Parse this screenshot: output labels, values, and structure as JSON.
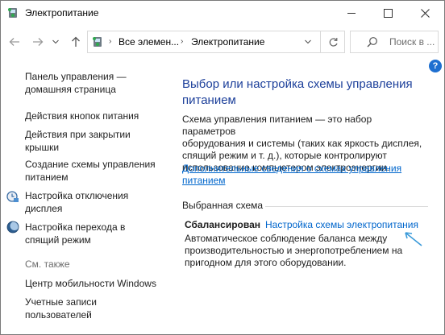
{
  "window": {
    "title": "Электропитание",
    "app_icon": "power-options-icon",
    "controls": [
      "minimize-icon",
      "maximize-icon",
      "close-icon"
    ]
  },
  "address_bar": {
    "breadcrumbs": [
      "Все элемен...",
      "Электропитание"
    ],
    "search_placeholder": "Поиск в ..."
  },
  "sidebar": {
    "items": [
      {
        "label": "Панель управления —\nдомашняя страница"
      },
      {
        "label": "Действия кнопок питания"
      },
      {
        "label": "Действия при закрытии\nкрышки"
      },
      {
        "label": "Создание схемы управления\nпитанием"
      },
      {
        "label": "Настройка отключения\nдисплея",
        "icon": "display-timer-icon"
      },
      {
        "label": "Настройка перехода в\nспящий режим",
        "icon": "sleep-moon-icon"
      }
    ],
    "see_also_title": "См. также",
    "see_also_items": [
      {
        "label": "Центр мобильности Windows"
      },
      {
        "label": "Учетные записи\nпользователей"
      }
    ]
  },
  "main": {
    "title": "Выбор или настройка схемы управления\nпитанием",
    "description": "Схема управления питанием — это набор параметров\nоборудования и системы (таких как яркость дисплея,\nспящий режим и т. д.), которые контролируют\nиспользование компьютером электроэнергии.",
    "more_link": "Дополнительные сведения о схемах управления\nпитанием",
    "selected_section": "Выбранная схема",
    "plan": {
      "name": "Сбалансирован",
      "settings_link": "Настройка схемы электропитания",
      "description": "Автоматическое соблюдение баланса между\nпроизводительностью и энергопотреблением на\nпригодном для этого оборудовании."
    }
  },
  "colors": {
    "link": "#0066cc",
    "heading": "#1c3f9a",
    "help_badge": "#1e6fd0",
    "annotation_arrow": "#3a9ad9"
  }
}
